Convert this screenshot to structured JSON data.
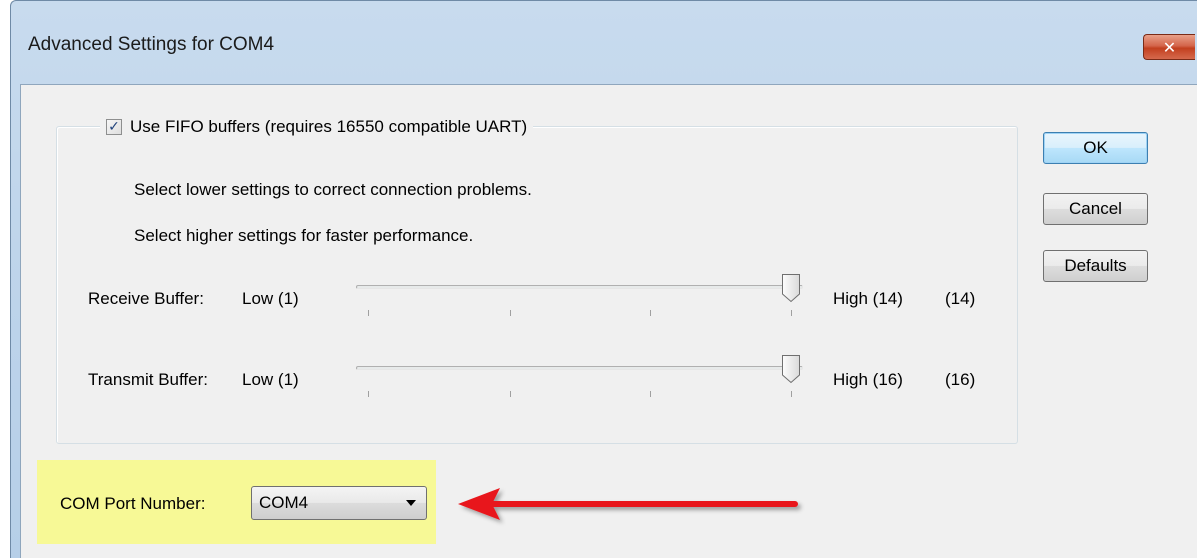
{
  "window": {
    "title": "Advanced Settings for COM4",
    "close_glyph": "✕"
  },
  "fifo": {
    "label": "Use FIFO buffers (requires 16550 compatible UART)",
    "checked": true,
    "check_glyph": "✓"
  },
  "info": {
    "line1": "Select lower settings to correct connection problems.",
    "line2": "Select higher settings for faster performance."
  },
  "receive": {
    "label": "Receive Buffer:",
    "low": "Low (1)",
    "high": "High (14)",
    "value": "(14)",
    "level": 1.0
  },
  "transmit": {
    "label": "Transmit Buffer:",
    "low": "Low (1)",
    "high": "High (16)",
    "value": "(16)",
    "level": 1.0
  },
  "buttons": {
    "ok": "OK",
    "cancel": "Cancel",
    "defaults": "Defaults"
  },
  "com_port": {
    "label": "COM Port Number:",
    "selected": "COM4"
  },
  "colors": {
    "highlight": "#f7f996",
    "arrow": "#e8171b",
    "default_button_border": "#3c7fb1"
  },
  "icons": {
    "checkbox": "checkmark-icon",
    "close": "close-x-icon",
    "dropdown": "chevron-down-icon",
    "annotation": "red-arrow-icon"
  }
}
